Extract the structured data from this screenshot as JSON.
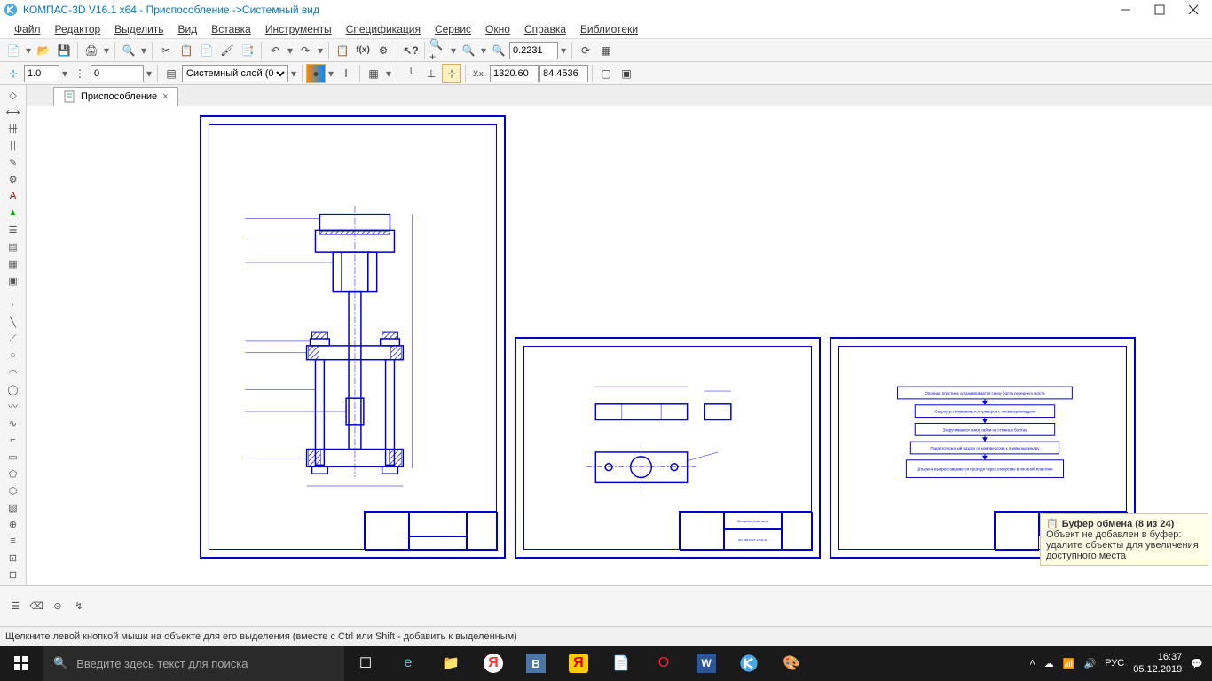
{
  "titlebar": {
    "title": "КОМПАС-3D V16.1 x64 - Приспособление ->Системный вид"
  },
  "menubar": {
    "items": [
      "Файл",
      "Редактор",
      "Выделить",
      "Вид",
      "Вставка",
      "Инструменты",
      "Спецификация",
      "Сервис",
      "Окно",
      "Справка",
      "Библиотеки"
    ]
  },
  "toolbar1": {
    "zoom_value": "0.2231"
  },
  "toolbar2": {
    "line_width": "1.0",
    "line_style": "0",
    "layer": "Системный слой (0)",
    "coord_x": "1320.60",
    "coord_y": "84.4536"
  },
  "doc_tab": {
    "name": "Приспособление"
  },
  "sheets": {
    "sheet2_title": "Опорная пластина",
    "sheet2_material": "Лат Л68 ГОСТ 17711-93",
    "flow_steps": [
      "Опорная пластина устанавливается снизу болта переднего моста",
      "Сверху устанавливается траверса с пневмоцилиндром",
      "Закручивается снизу гайки на стяжных болтах",
      "Подается сжатый воздух от компрессора к пневмоцилиндру",
      "Штырень выпрессовывается проходя через отверстие в опорной пластине"
    ]
  },
  "clipboard_tip": {
    "title": "Буфер обмена (8 из 24)",
    "body": "Объект не добавлен в буфер: удалите объекты для увеличения доступного места"
  },
  "statusbar": {
    "hint": "Щелкните левой кнопкой мыши на объекте для его выделения (вместе с Ctrl или Shift - добавить к выделенным)"
  },
  "taskbar": {
    "search_placeholder": "Введите здесь текст для поиска",
    "lang": "РУС",
    "time": "16:37",
    "date": "05.12.2019"
  }
}
